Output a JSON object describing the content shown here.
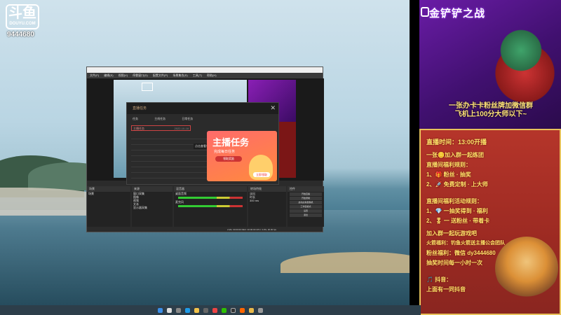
{
  "branding": {
    "logo_text": "斗鱼",
    "logo_domain": "DOUYU.COM",
    "room_id": "9444680"
  },
  "obs": {
    "menu": [
      "文件(F)",
      "编辑(E)",
      "视图(V)",
      "停靠窗口(D)",
      "配置文件(P)",
      "场景集合(S)",
      "工具(T)",
      "帮助(H)"
    ],
    "dialog": {
      "title": "直播任务",
      "tabs": [
        "任务",
        "主线任务",
        "日常任务"
      ],
      "task_row": "主播任务",
      "task_row_date": "2022-10-18",
      "hint": "点击查看领取奖励",
      "card_title": "主播任务",
      "card_subtitle": "完成每日任务",
      "card_button": "领取奖励",
      "card_go": "立即领取"
    },
    "docks": {
      "scenes": "场景",
      "sources": "来源",
      "mixer": "混音器",
      "transitions": "转场特效",
      "controls": "控件",
      "scene_items": [
        "场景"
      ],
      "source_items": [
        "窗口采集",
        "图像",
        "视频",
        "文本",
        "显示器采集"
      ],
      "mixer_items": [
        "桌面音频",
        "麦克风"
      ],
      "transition_value": "淡出",
      "duration_label": "时长",
      "duration_value": "300 ms",
      "control_buttons": [
        "开始直播",
        "开始录制",
        "启动虚拟摄像机",
        "工作室模式",
        "设置",
        "退出"
      ]
    },
    "status": "LIVE: 00:00:00  REC: 00:00:00  CPU: 3.0%, 30.00 fps"
  },
  "banner": {
    "title": "金铲铲之战",
    "promo_line1": "一张办卡卡粉丝牌加微信群",
    "promo_line2": "飞机上100分大师以下~"
  },
  "schedule": {
    "time_line": "直播时间：13:00开播",
    "lines": [
      "一张🪙加入群一起练团",
      "直播间福利规则：",
      "1、🎁 粉丝 · 抽奖",
      "2、🚀 免费定制 · 上大师",
      "直播间福利活动规则：",
      "1、💎 一抽奖得到 · 福利",
      "2、🎖 一 送粉丝 · 带着卡",
      "加入群一起玩游戏吧",
      "火箭福利：钓鱼火箭送主播公会团队",
      "粉丝福利：微信 dy3444680",
      "抽奖时间每一小时一次",
      "🎵 抖音：",
      "上面有一同抖音"
    ]
  },
  "taskbar": {
    "icons": [
      "windows-icon",
      "search-icon",
      "taskview-icon",
      "edge-icon",
      "explorer-icon",
      "store-icon",
      "chrome-icon",
      "wechat-icon",
      "obs-icon",
      "douyu-icon",
      "folder-icon",
      "settings-icon"
    ]
  },
  "colors": {
    "accent_gold": "#ffe56b",
    "banner_purple": "#6a1ca6",
    "schedule_red": "#b5352a",
    "task_orange": "#ff6b6b"
  }
}
